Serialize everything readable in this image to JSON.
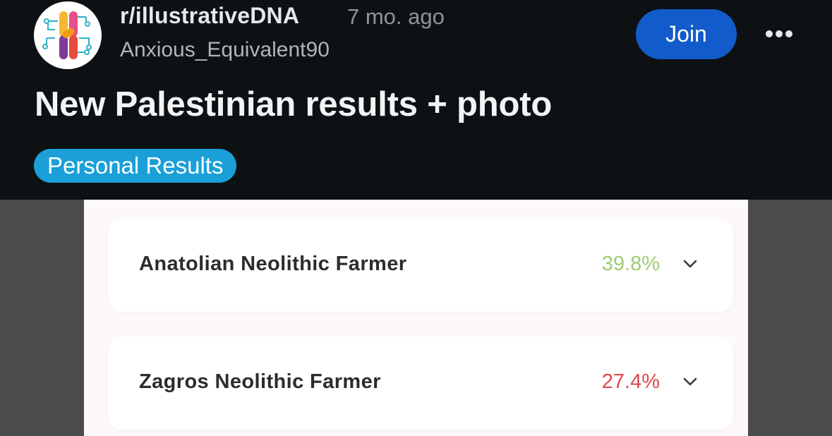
{
  "post": {
    "subreddit": "r/illustrativeDNA",
    "time_ago": "7 mo. ago",
    "author": "Anxious_Equivalent90",
    "join_label": "Join",
    "more_icon": "ellipsis-icon",
    "title": "New Palestinian results + photo",
    "flair": "Personal Results"
  },
  "results": [
    {
      "name": "Anatolian Neolithic Farmer",
      "percent": "39.8%",
      "color": "#9fcc73"
    },
    {
      "name": "Zagros Neolithic Farmer",
      "percent": "27.4%",
      "color": "#e0474c"
    }
  ],
  "colors": {
    "background": "#0e1113",
    "join_button": "#115bca",
    "flair": "#1a9fd8"
  }
}
